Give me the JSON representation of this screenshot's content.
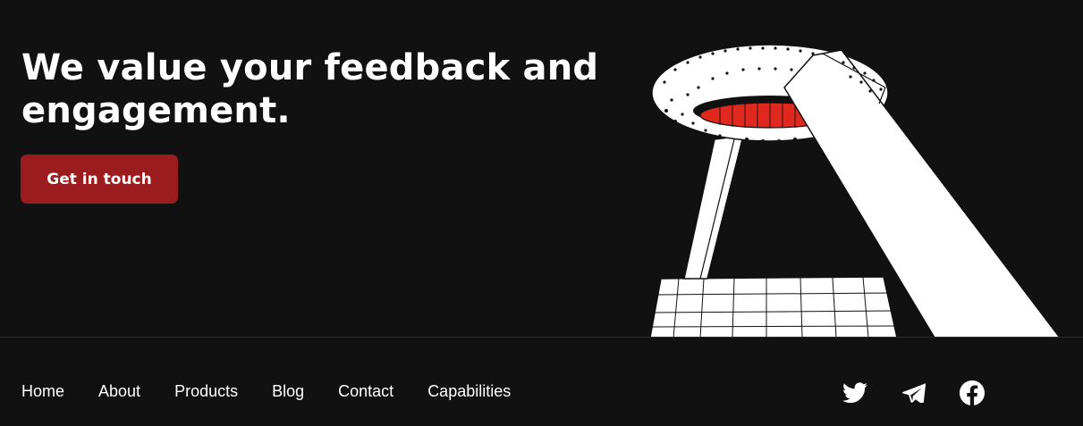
{
  "hero": {
    "title": "We value your feedback and engagement.",
    "cta_label": "Get in touch"
  },
  "footer": {
    "nav": [
      {
        "label": "Home"
      },
      {
        "label": "About"
      },
      {
        "label": "Products"
      },
      {
        "label": "Blog"
      },
      {
        "label": "Contact"
      },
      {
        "label": "Capabilities"
      }
    ],
    "social": [
      {
        "icon": "twitter-icon"
      },
      {
        "icon": "telegram-icon"
      },
      {
        "icon": "facebook-icon"
      }
    ]
  },
  "colors": {
    "background": "#111112",
    "accent": "#9b1c1f",
    "illustration_red": "#e0281e",
    "text": "#ffffff"
  }
}
